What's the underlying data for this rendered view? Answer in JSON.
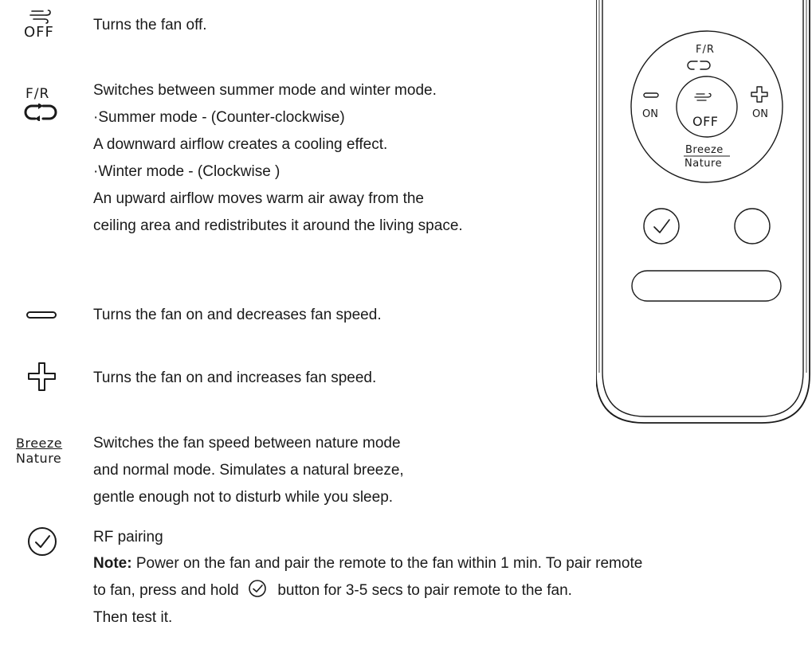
{
  "items": [
    {
      "icon_name": "wind-off-icon",
      "icon_label": "OFF",
      "lines": [
        "Turns the fan off."
      ]
    },
    {
      "icon_name": "reverse-icon",
      "icon_label": "F/R",
      "lines": [
        "Switches between summer mode and winter mode.",
        "·Summer mode - (Counter-clockwise)",
        "A downward airflow creates a cooling effect.",
        "·Winter mode - (Clockwise )",
        "An upward airflow moves warm air away from the",
        "ceiling area and redistributes it around the living space."
      ]
    },
    {
      "icon_name": "minus-icon",
      "lines": [
        "Turns the fan on and decreases fan speed."
      ]
    },
    {
      "icon_name": "plus-icon",
      "lines": [
        "Turns the fan on and increases fan speed."
      ]
    },
    {
      "icon_name": "breeze-nature-icon",
      "icon_label_top": "Breeze",
      "icon_label_bottom": "Nature",
      "lines": [
        "Switches the fan speed between nature mode",
        "and normal mode. Simulates a natural breeze,",
        "gentle enough not to disturb while you sleep."
      ]
    },
    {
      "icon_name": "check-circle-icon",
      "title": "RF pairing",
      "note_label": "Note:",
      "note_text": " Power on the fan and pair the remote to the fan within 1 min. To pair remote",
      "line2_a": "to fan, press and hold",
      "line2_b": "button for 3-5 secs to pair remote to the fan.",
      "line3": "Then test it."
    }
  ],
  "remote": {
    "fr_label": "F/R",
    "off_label": "OFF",
    "on_left_label": "ON",
    "on_right_label": "ON",
    "breeze_label": "Breeze",
    "nature_label": "Nature"
  }
}
